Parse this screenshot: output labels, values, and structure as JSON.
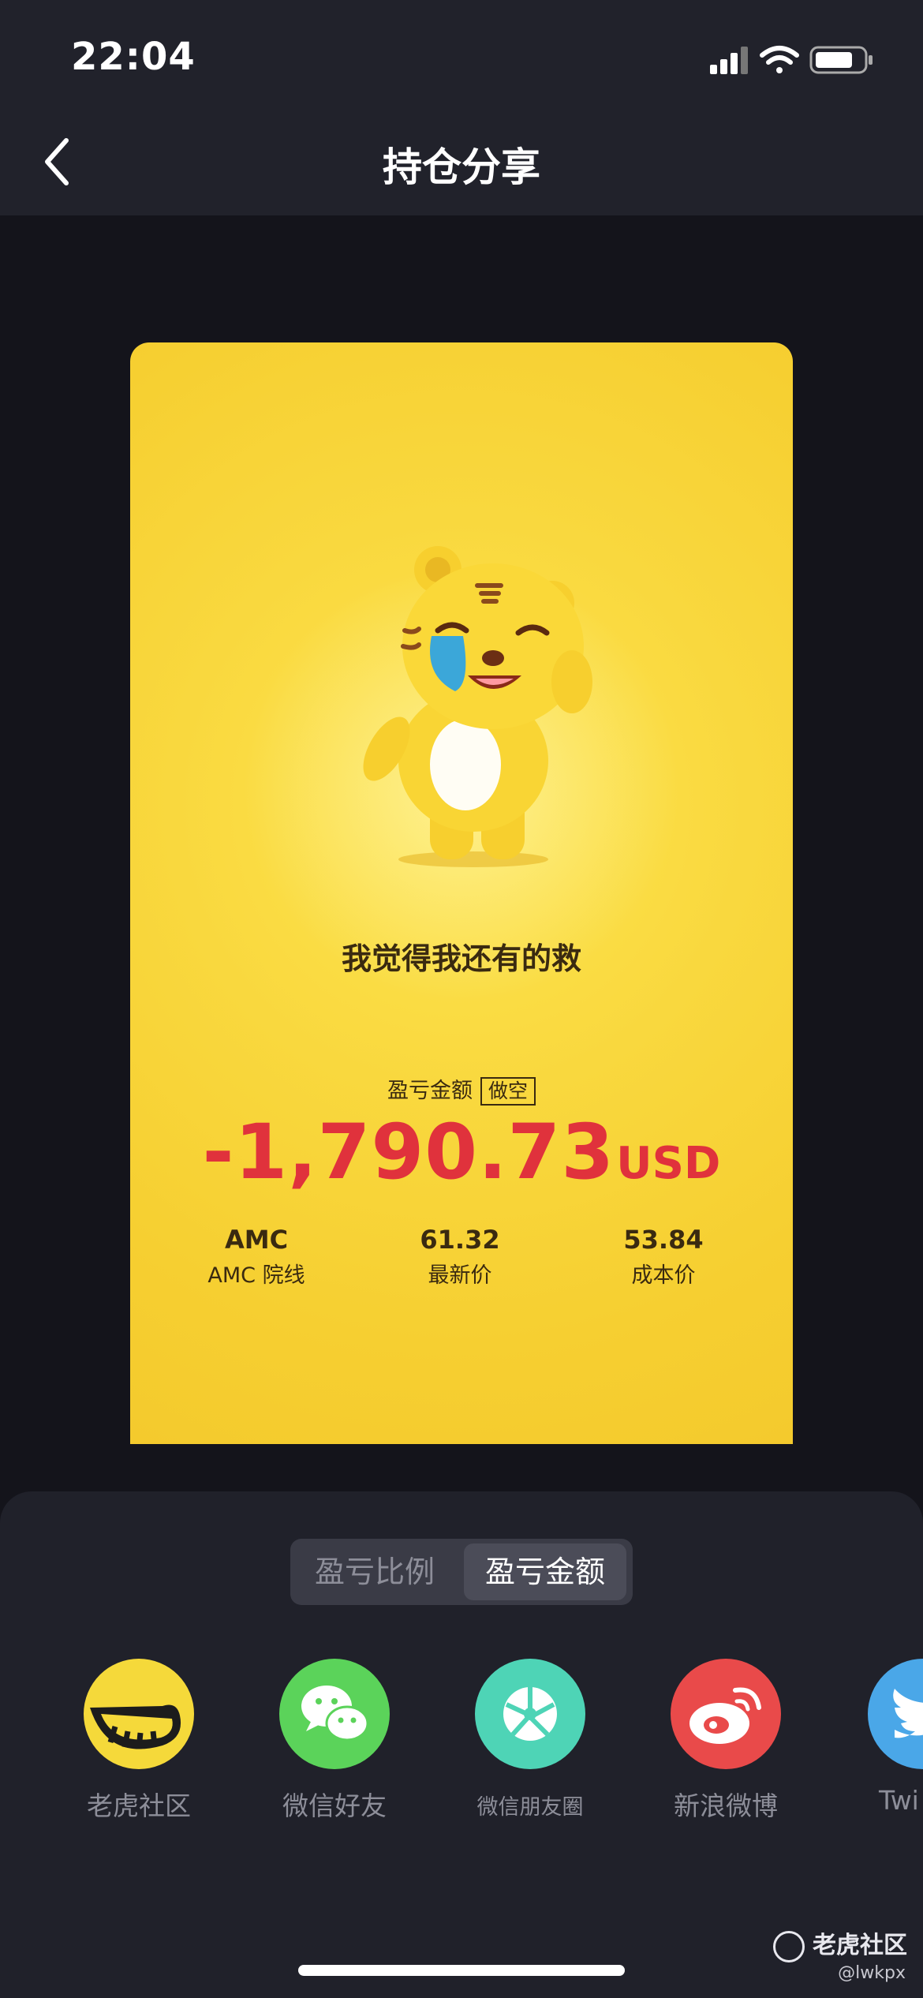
{
  "status_bar": {
    "time": "22:04"
  },
  "nav": {
    "title": "持仓分享"
  },
  "card": {
    "quote": "我觉得我还有的救",
    "pl_label": "盈亏金额",
    "pl_tag": "做空",
    "pl_amount": "-1,790.73",
    "pl_unit": "USD",
    "stats": [
      {
        "value": "AMC",
        "label": "AMC 院线"
      },
      {
        "value": "61.32",
        "label": "最新价"
      },
      {
        "value": "53.84",
        "label": "成本价"
      }
    ]
  },
  "segmented": {
    "options": [
      "盈亏比例",
      "盈亏金额"
    ],
    "selected": "盈亏金额"
  },
  "share_targets": [
    {
      "label": "老虎社区",
      "icon": "tiger-icon",
      "color": "#f5d93a"
    },
    {
      "label": "微信好友",
      "icon": "wechat-icon",
      "color": "#5bd35a"
    },
    {
      "label": "微信朋友圈",
      "icon": "moments-icon",
      "color": "#4ed4b6"
    },
    {
      "label": "新浪微博",
      "icon": "weibo-icon",
      "color": "#e94a4a"
    },
    {
      "label": "Twi",
      "icon": "twitter-icon",
      "color": "#4aa7e8"
    }
  ],
  "watermark": {
    "text": "老虎社区",
    "handle": "@lwkpx"
  },
  "colors": {
    "card_yellow": "#f8d63c",
    "loss_red": "#e0323c",
    "sheet_bg": "#20212a"
  }
}
